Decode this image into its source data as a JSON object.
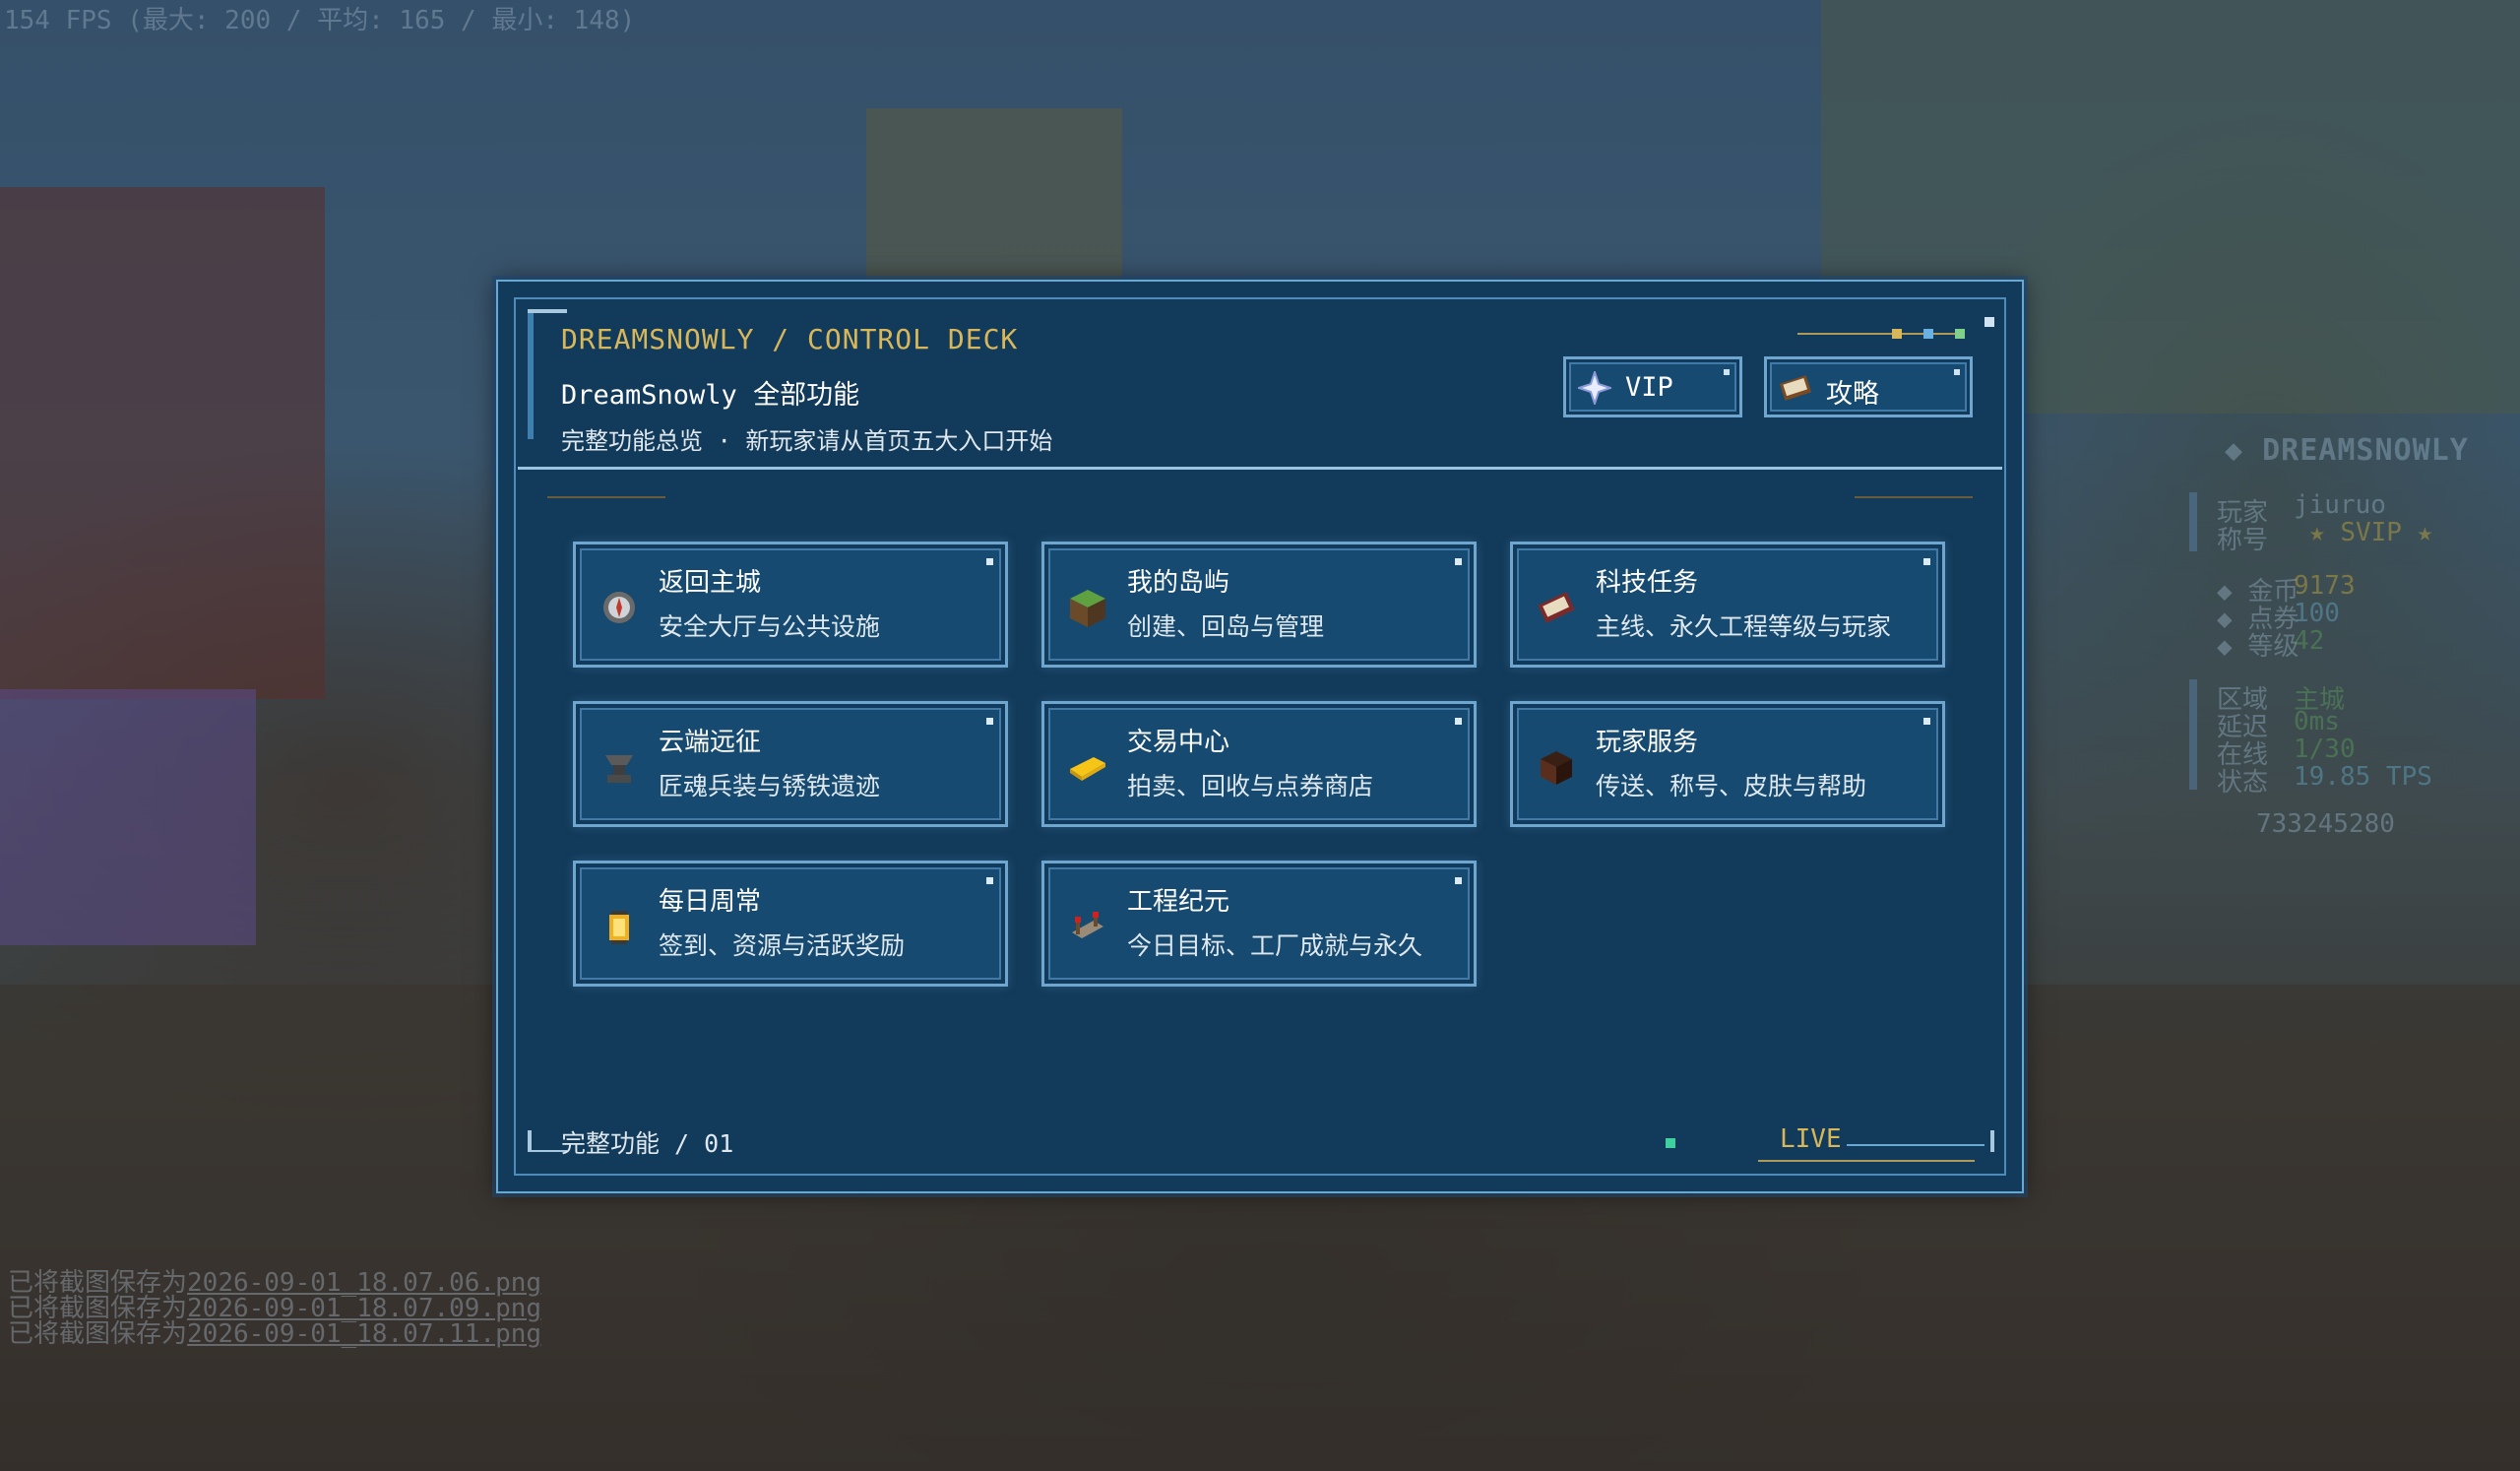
{
  "overlay": {
    "fps_text": "154 FPS (最大: 200 / 平均: 165 / 最小: 148)",
    "chat": [
      {
        "prefix": "已将截图保存为",
        "file": "2026-09-01_18.07.06.png"
      },
      {
        "prefix": "已将截图保存为",
        "file": "2026-09-01_18.07.09.png"
      },
      {
        "prefix": "已将截图保存为",
        "file": "2026-09-01_18.07.11.png"
      }
    ]
  },
  "hud": {
    "brand": "DREAMSNOWLY",
    "player_label": "玩家",
    "player_value": "jiuruo",
    "title_label": "称号",
    "title_value": "SVIP",
    "gold_label": "金币",
    "gold_value": "9173",
    "points_label": "点券",
    "points_value": "100",
    "level_label": "等级",
    "level_value": "42",
    "region_label": "区域",
    "region_value": "主城",
    "ping_label": "延迟",
    "ping_value": "0ms",
    "online_label": "在线",
    "online_value": "1/30",
    "status_label": "状态",
    "status_value": "19.85 TPS",
    "id_number": "733245280"
  },
  "panel": {
    "title_en": "DREAMSNOWLY / CONTROL DECK",
    "title_main": "DreamSnowly 全部功能",
    "subtitle": "完整功能总览 · 新玩家请从首页五大入口开始",
    "vip_button": "VIP",
    "guide_button": "攻略",
    "footer_page": "完整功能 / 01",
    "footer_live": "LIVE",
    "colors": {
      "accent": "#d8b75a",
      "panel_bg": "#123a5a",
      "card_border": "#6ea6cf"
    },
    "cards": [
      {
        "title": "返回主城",
        "desc": "安全大厅与公共设施",
        "icon": "compass-icon"
      },
      {
        "title": "我的岛屿",
        "desc": "创建、回岛与管理",
        "icon": "grass-block-icon"
      },
      {
        "title": "科技任务",
        "desc": "主线、永久工程等级与玩家",
        "icon": "book-icon"
      },
      {
        "title": "云端远征",
        "desc": "匠魂兵装与锈铁遗迹",
        "icon": "anvil-icon"
      },
      {
        "title": "交易中心",
        "desc": "拍卖、回收与点券商店",
        "icon": "gold-ingot-icon"
      },
      {
        "title": "玩家服务",
        "desc": "传送、称号、皮肤与帮助",
        "icon": "player-head-icon"
      },
      {
        "title": "每日周常",
        "desc": "签到、资源与活跃奖励",
        "icon": "lantern-icon"
      },
      {
        "title": "工程纪元",
        "desc": "今日目标、工厂成就与永久",
        "icon": "redstone-icon"
      }
    ]
  }
}
